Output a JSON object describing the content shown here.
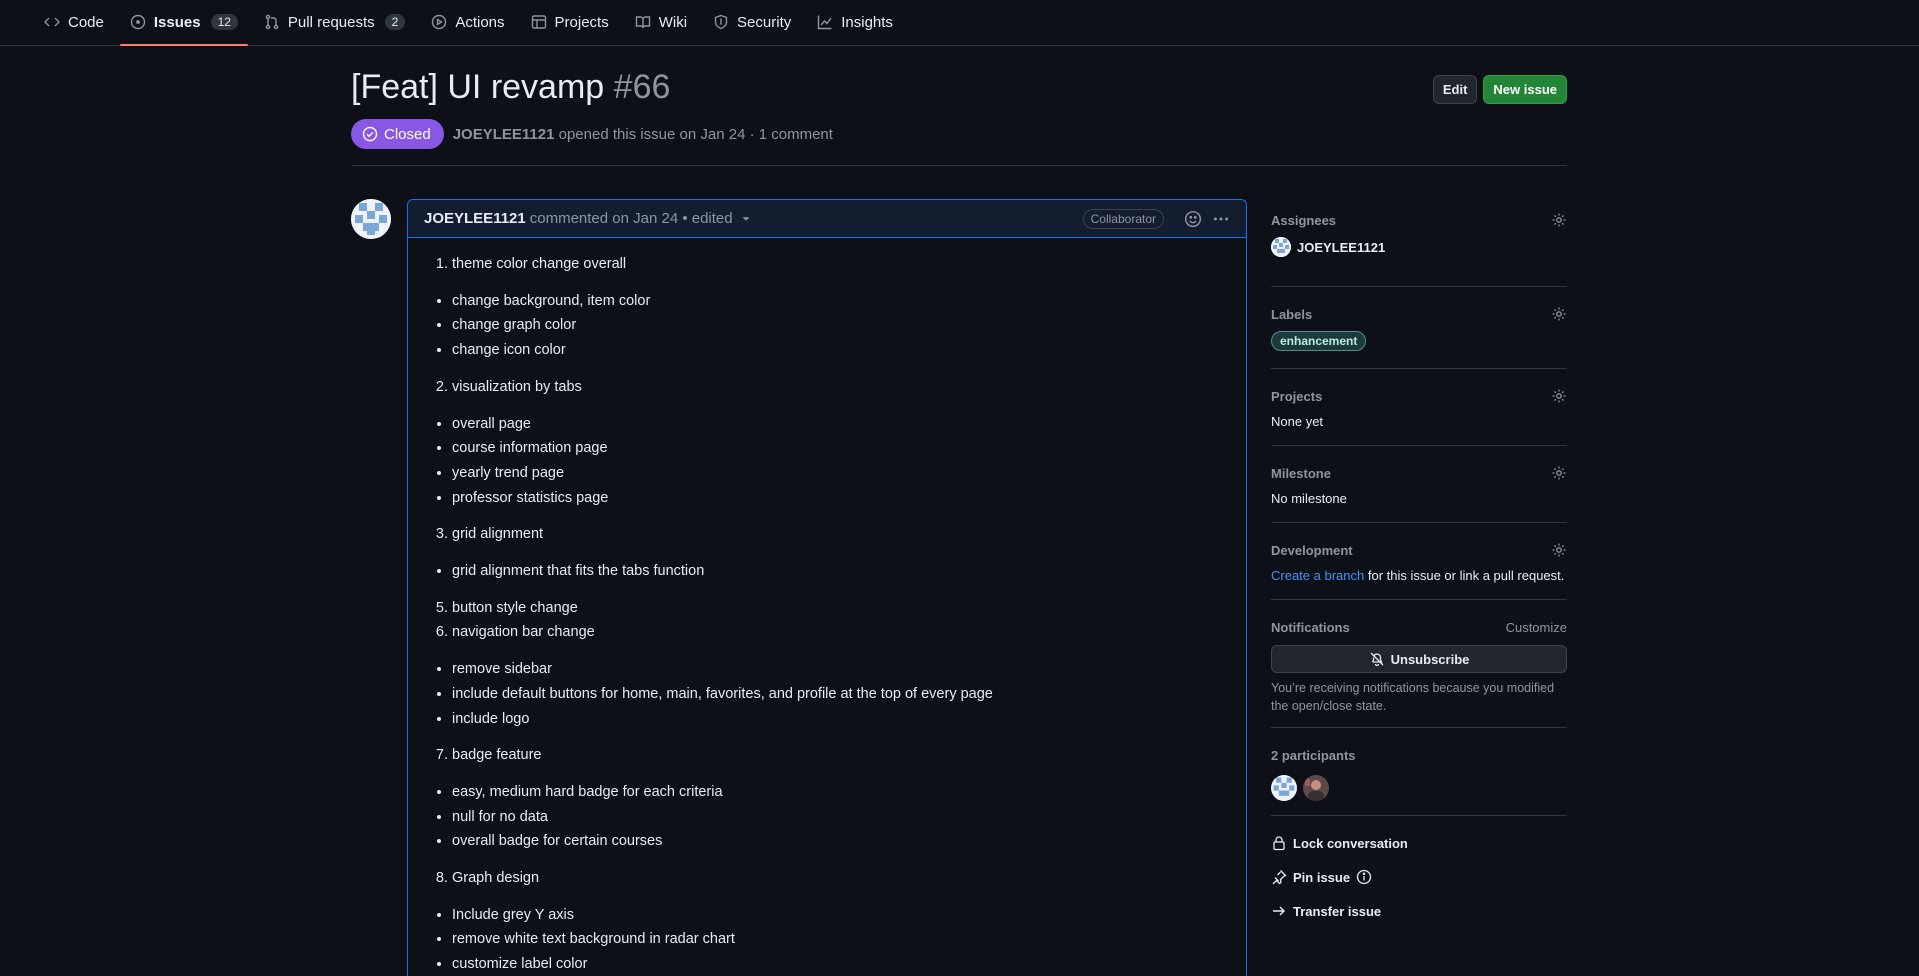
{
  "nav": {
    "items": [
      {
        "label": "Code",
        "icon": "code-icon"
      },
      {
        "label": "Issues",
        "icon": "issue-icon",
        "count": "12"
      },
      {
        "label": "Pull requests",
        "icon": "pull-request-icon",
        "count": "2"
      },
      {
        "label": "Actions",
        "icon": "play-icon"
      },
      {
        "label": "Projects",
        "icon": "table-icon"
      },
      {
        "label": "Wiki",
        "icon": "book-icon"
      },
      {
        "label": "Security",
        "icon": "shield-icon"
      },
      {
        "label": "Insights",
        "icon": "graph-icon"
      }
    ]
  },
  "issue": {
    "title": "[Feat] UI revamp",
    "number": "#66",
    "state": "Closed",
    "author": "JOEYLEE1121",
    "meta": "opened this issue on Jan 24 · 1 comment",
    "edit_label": "Edit",
    "new_issue_label": "New issue"
  },
  "comment": {
    "author": "JOEYLEE1121",
    "meta": "commented on Jan 24 • edited",
    "role": "Collaborator",
    "body": {
      "s1": "theme color change overall",
      "s1_items": [
        "change background, item color",
        "change graph color",
        "change icon color"
      ],
      "s2": "visualization by tabs",
      "s2_items": [
        "overall page",
        "course information page",
        "yearly trend page",
        "professor statistics page"
      ],
      "s3": "grid alignment",
      "s3_items": [
        "grid alignment that fits the tabs function"
      ],
      "s5": "button style change",
      "s6": "navigation bar change",
      "s6_items": [
        "remove sidebar",
        "include default buttons for home, main, favorites, and profile at the top of every page",
        "include logo"
      ],
      "s7": "badge feature",
      "s7_items": [
        "easy, medium hard badge for each criteria",
        "null for no data",
        "overall badge for certain courses"
      ],
      "s8": "Graph design",
      "s8_items": [
        "Include grey Y axis",
        "remove white text background in radar chart",
        "customize label color"
      ]
    }
  },
  "sidebar": {
    "assignees": {
      "title": "Assignees",
      "value": "JOEYLEE1121"
    },
    "labels": {
      "title": "Labels",
      "value": "enhancement"
    },
    "projects": {
      "title": "Projects",
      "value": "None yet"
    },
    "milestone": {
      "title": "Milestone",
      "value": "No milestone"
    },
    "development": {
      "title": "Development",
      "link": "Create a branch",
      "rest": " for this issue or link a pull request."
    },
    "notifications": {
      "title": "Notifications",
      "customize": "Customize",
      "button": "Unsubscribe",
      "note": "You’re receiving notifications because you modified the open/close state."
    },
    "participants": {
      "title": "2 participants"
    },
    "actions": {
      "lock": "Lock conversation",
      "pin": "Pin issue",
      "transfer": "Transfer issue"
    }
  },
  "colors": {
    "accent": "#1f6feb",
    "closed": "#8957e5",
    "primary_button": "#238636",
    "tab_underline": "#f78166"
  }
}
